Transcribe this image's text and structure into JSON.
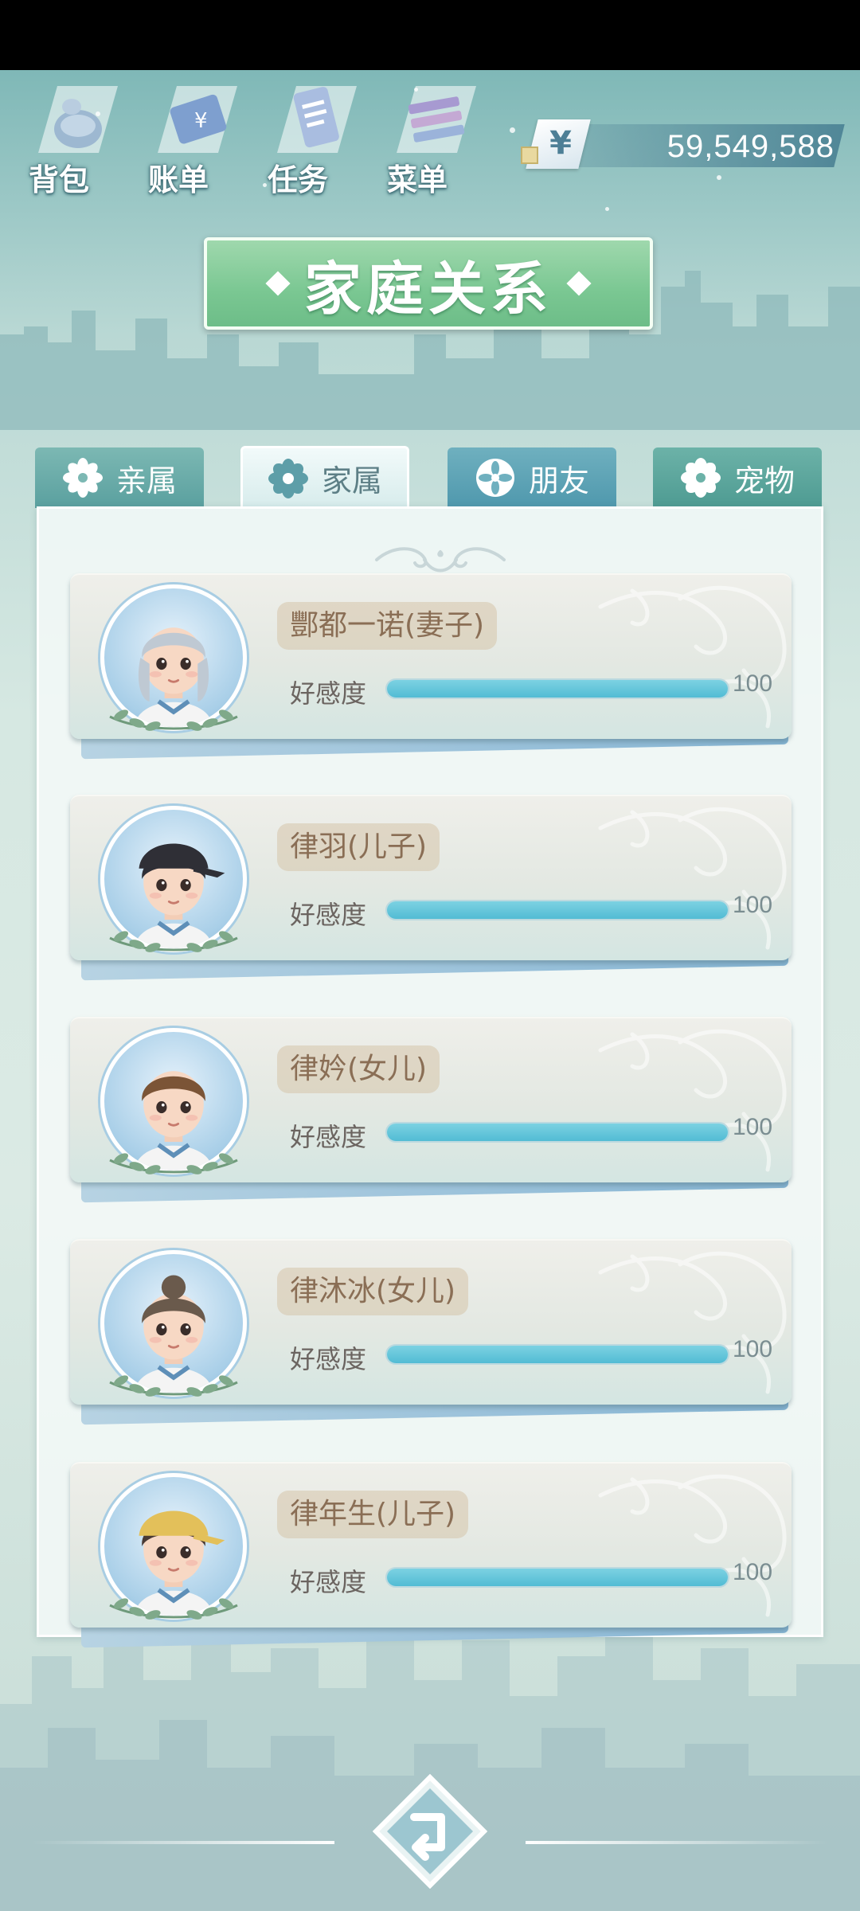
{
  "topbar": {
    "items": [
      {
        "label": "背包",
        "icon": "bag-icon"
      },
      {
        "label": "账单",
        "icon": "bill-icon"
      },
      {
        "label": "任务",
        "icon": "task-icon"
      },
      {
        "label": "菜单",
        "icon": "menu-icon"
      }
    ],
    "currency_symbol": "¥",
    "money": "59,549,588"
  },
  "title": "家庭关系",
  "tabs": [
    {
      "label": "亲属",
      "active": false
    },
    {
      "label": "家属",
      "active": true
    },
    {
      "label": "朋友",
      "active": false
    },
    {
      "label": "宠物",
      "active": false
    }
  ],
  "affection_label": "好感度",
  "members": [
    {
      "name": "酆都一诺(妻子)",
      "affection": 100,
      "affection_max": 100
    },
    {
      "name": "律羽(儿子)",
      "affection": 100,
      "affection_max": 100
    },
    {
      "name": "律妗(女儿)",
      "affection": 100,
      "affection_max": 100
    },
    {
      "name": "律沐冰(女儿)",
      "affection": 100,
      "affection_max": 100
    },
    {
      "name": "律年生(儿子)",
      "affection": 100,
      "affection_max": 100
    }
  ],
  "colors": {
    "title_green": "#7ac792",
    "affection_bar": "#52bcd4",
    "name_tag_text": "#8a6e55"
  }
}
